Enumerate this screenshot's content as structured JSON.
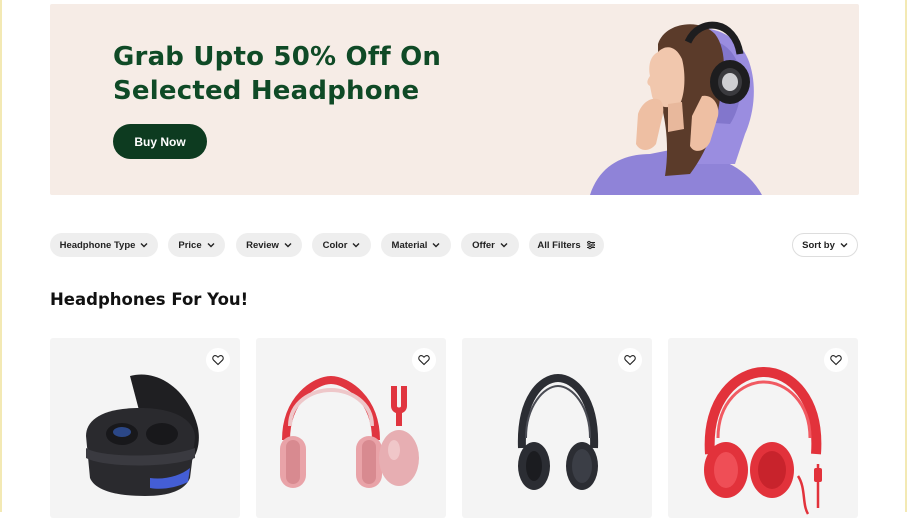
{
  "hero": {
    "title": "Grab Upto 50% Off On Selected Headphone",
    "button_label": "Buy Now",
    "background_color": "#f6ece6",
    "title_color": "#0f4a26",
    "button_color": "#0d3b20"
  },
  "filters": [
    {
      "label": "Headphone Type",
      "icon": "chevron-down-icon"
    },
    {
      "label": "Price",
      "icon": "chevron-down-icon"
    },
    {
      "label": "Review",
      "icon": "chevron-down-icon"
    },
    {
      "label": "Color",
      "icon": "chevron-down-icon"
    },
    {
      "label": "Material",
      "icon": "chevron-down-icon"
    },
    {
      "label": "Offer",
      "icon": "chevron-down-icon"
    },
    {
      "label": "All Filters",
      "icon": "sliders-icon"
    }
  ],
  "sort": {
    "label": "Sort by",
    "icon": "chevron-down-icon"
  },
  "section": {
    "title": "Headphones For You!"
  },
  "products": [
    {
      "image": "wireless-earbuds-case-image",
      "color": "#2a2a2e",
      "fav_icon": "heart-icon"
    },
    {
      "image": "pink-over-ear-headphones-image",
      "color": "#e9a3a8",
      "fav_icon": "heart-icon"
    },
    {
      "image": "black-noise-cancelling-headphones-image",
      "color": "#2b2d33",
      "fav_icon": "heart-icon"
    },
    {
      "image": "red-wired-headphones-image",
      "color": "#e2323b",
      "fav_icon": "heart-icon"
    }
  ]
}
